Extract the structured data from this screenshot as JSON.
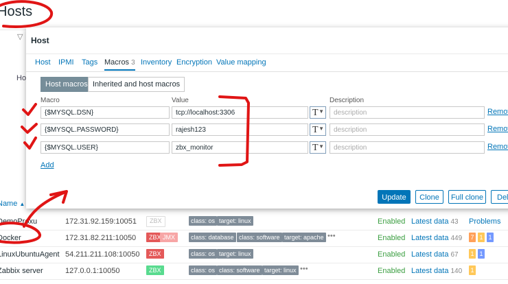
{
  "page": {
    "title": "Hosts",
    "partial_label": "Ho"
  },
  "table": {
    "name_header": "Name",
    "problems_header": "Problems",
    "rows": [
      {
        "name": "DemoProxu",
        "ip": "172.31.92.159:10051",
        "availability": "ZBX",
        "tags": [
          "class: os",
          "target: linux"
        ],
        "status": "Enabled",
        "latest": "Latest data",
        "latest_count": "43",
        "more": false
      },
      {
        "name": "Docker",
        "ip": "172.31.82.211:10050",
        "availability": "ZBX",
        "availability2": "JMX",
        "tags": [
          "class: database",
          "class: software",
          "target: apache"
        ],
        "status": "Enabled",
        "latest": "Latest data",
        "latest_count": "449",
        "problems": [
          "7",
          "1",
          "1"
        ],
        "more": true
      },
      {
        "name": "LinuxUbuntuAgent",
        "ip": "54.211.211.108:10050",
        "availability": "ZBX",
        "tags": [
          "class: os",
          "target: linux"
        ],
        "status": "Enabled",
        "latest": "Latest data",
        "latest_count": "67",
        "problems": [
          "1",
          "1"
        ],
        "more": false
      },
      {
        "name": "Zabbix server",
        "ip": "127.0.0.1:10050",
        "availability": "ZBX",
        "tags": [
          "class: os",
          "class: software",
          "target: linux"
        ],
        "status": "Enabled",
        "latest": "Latest data",
        "latest_count": "140",
        "problems": [
          "1"
        ],
        "more": true
      }
    ]
  },
  "modal": {
    "title": "Host",
    "tabs": [
      {
        "label": "Host"
      },
      {
        "label": "IPMI"
      },
      {
        "label": "Tags"
      },
      {
        "label": "Macros",
        "count": "3",
        "active": true
      },
      {
        "label": "Inventory"
      },
      {
        "label": "Encryption"
      },
      {
        "label": "Value mapping"
      }
    ],
    "segments": {
      "host_macros": "Host macros",
      "inherited": "Inherited and host macros"
    },
    "columns": {
      "macro": "Macro",
      "value": "Value",
      "description": "Description"
    },
    "macros": [
      {
        "macro": "{$MYSQL.DSN}",
        "value": "tcp://localhost:3306",
        "type": "T",
        "description_placeholder": "description",
        "remove": "Remove"
      },
      {
        "macro": "{$MYSQL.PASSWORD}",
        "value": "rajesh123",
        "type": "T",
        "description_placeholder": "description",
        "remove": "Remove"
      },
      {
        "macro": "{$MYSQL.USER}",
        "value": "zbx_monitor",
        "type": "T",
        "description_placeholder": "description",
        "remove": "Remove"
      }
    ],
    "add_label": "Add",
    "buttons": {
      "update": "Update",
      "clone": "Clone",
      "full_clone": "Full clone",
      "delete": "Delete"
    }
  },
  "colors": {
    "accent": "#0275b8",
    "annotation": "#e01515",
    "enabled": "#3b9e41"
  },
  "icons": {
    "filter": "filter-icon",
    "type_select": "text-type-icon",
    "sort": "sort-asc-icon"
  }
}
